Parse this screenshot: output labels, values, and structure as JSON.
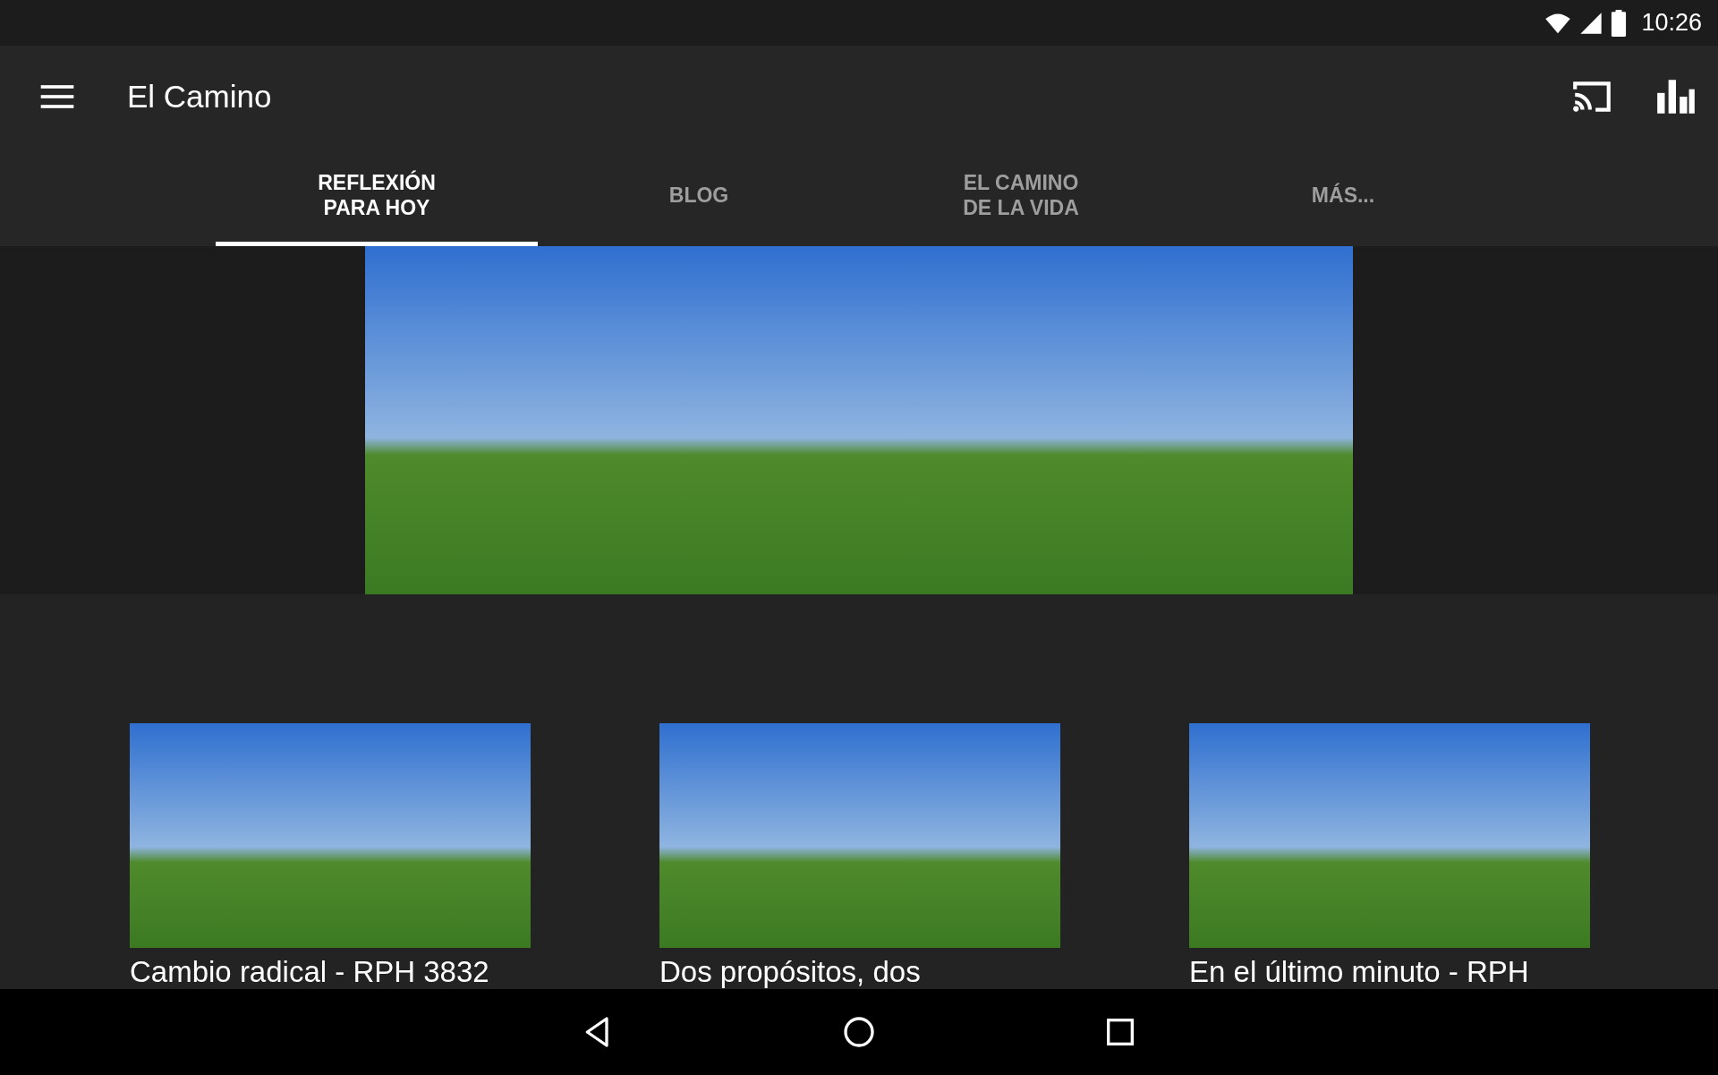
{
  "status_bar": {
    "time": "10:26"
  },
  "toolbar": {
    "title": "El Camino"
  },
  "tabs": [
    {
      "label": "REFLEXIÓN\nPARA HOY",
      "selected": true
    },
    {
      "label": "BLOG",
      "selected": false
    },
    {
      "label": "EL CAMINO\nDE LA VIDA",
      "selected": false
    },
    {
      "label": "MÁS...",
      "selected": false
    }
  ],
  "cards": [
    {
      "title": "Cambio radical - RPH 3832"
    },
    {
      "title": "Dos propósitos, dos"
    },
    {
      "title": "En el último minuto - RPH"
    }
  ]
}
